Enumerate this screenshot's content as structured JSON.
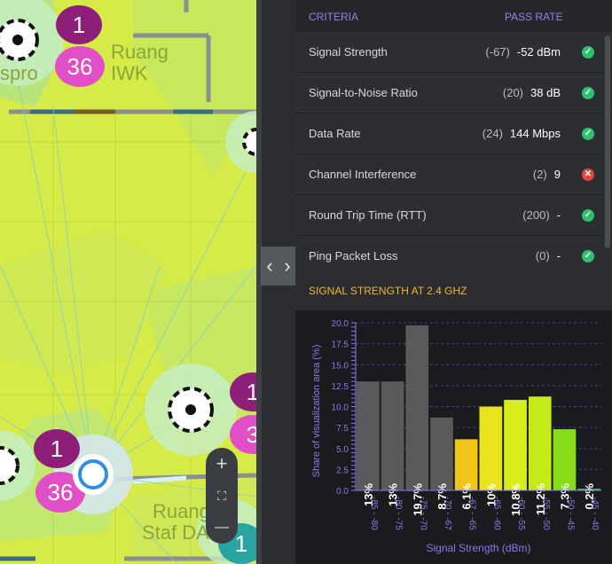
{
  "map": {
    "room_labels": [
      "Ruang",
      "IWK",
      "Ruang",
      "Staf DA"
    ],
    "partial_label": "spro",
    "pins": [
      {
        "label": "1",
        "color": "#8e1f78"
      },
      {
        "label": "36",
        "color": "#e04fc5"
      },
      {
        "label": "1",
        "color": "#8e1f78"
      },
      {
        "label": "36",
        "color": "#e04fc5"
      },
      {
        "label": "1",
        "color": "#8e1f78"
      },
      {
        "label": "3",
        "color": "#e04fc5"
      },
      {
        "label": "1",
        "color": "#2aa3a3"
      }
    ],
    "zoom": {
      "in_label": "+",
      "fit_label": "⛶",
      "out_label": "—"
    }
  },
  "divider": {
    "left_arrow": "‹",
    "right_arrow": "›"
  },
  "criteria": {
    "header_criteria": "CRITERIA",
    "header_pass_rate": "PASS RATE",
    "rows": [
      {
        "name": "Signal Strength",
        "required": "(-67)",
        "value": "-52 dBm",
        "status": "pass"
      },
      {
        "name": "Signal-to-Noise Ratio",
        "required": "(20)",
        "value": "38 dB",
        "status": "pass"
      },
      {
        "name": "Data Rate",
        "required": "(24)",
        "value": "144 Mbps",
        "status": "pass"
      },
      {
        "name": "Channel Interference",
        "required": "(2)",
        "value": "9",
        "status": "fail"
      },
      {
        "name": "Round Trip Time (RTT)",
        "required": "(200)",
        "value": "-",
        "status": "pass"
      },
      {
        "name": "Ping Packet Loss",
        "required": "(0)",
        "value": "-",
        "status": "pass"
      }
    ],
    "status_colors": {
      "pass": "#2fbf71",
      "fail": "#e0453f"
    }
  },
  "signal_section": {
    "title": "SIGNAL STRENGTH AT 2.4 GHZ"
  },
  "chart_data": {
    "type": "bar",
    "categories": [
      "-85 - -80",
      "-80 - -75",
      "-75 - -70",
      "-70 - -67",
      "-67 - -65",
      "-65 - -60",
      "-60 - -55",
      "-55 - -50",
      "-50 - -45",
      "-45 - -40"
    ],
    "values": [
      13,
      13,
      19.7,
      8.7,
      6.1,
      10,
      10.8,
      11.2,
      7.3,
      0.2
    ],
    "data_labels": [
      "13%",
      "13%",
      "19.7%",
      "8.7%",
      "6.1%",
      "10%",
      "10.8%",
      "11.2%",
      "7.3%",
      "0.2%"
    ],
    "colors": [
      "#5a5a5a",
      "#5a5a5a",
      "#5a5a5a",
      "#5a5a5a",
      "#f0c419",
      "#e8e31c",
      "#d7ee1b",
      "#c4ea1a",
      "#86dd18",
      "#3ec832"
    ],
    "yticks": [
      "0.0",
      "2.5",
      "5.0",
      "7.5",
      "10.0",
      "12.5",
      "15.0",
      "17.5",
      "20.0"
    ],
    "ylim": [
      0,
      20
    ],
    "xlabel": "Signal Strength (dBm)",
    "ylabel": "Share of visualization area (%)",
    "grid": true
  }
}
